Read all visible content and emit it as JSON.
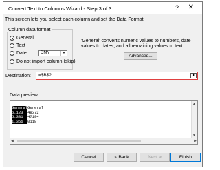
{
  "window": {
    "title": "Convert Text to Columns Wizard - Step 3 of 3",
    "help_glyph": "?",
    "close_glyph": "✕"
  },
  "instructions": "This screen lets you select each column and set the Data Format.",
  "column_format": {
    "group_label": "Column data format",
    "options": [
      {
        "label": "General",
        "selected": true
      },
      {
        "label": "Text",
        "selected": false
      },
      {
        "label": "Date:",
        "selected": false
      },
      {
        "label": "Do not import column (skip)",
        "selected": false
      }
    ],
    "date_format": "DMY"
  },
  "description": "'General' converts numeric values to numbers, date values to dates, and all remaining values to text.",
  "advanced_label": "Advanced...",
  "destination": {
    "label": "Destination:",
    "value": "=$B$2"
  },
  "preview": {
    "label": "Data preview",
    "rows": [
      [
        "General",
        "General"
      ],
      [
        "6.123",
        "48372"
      ],
      [
        "5.331",
        "47194"
      ],
      [
        "1.356",
        "0118"
      ]
    ]
  },
  "buttons": {
    "cancel": "Cancel",
    "back": "< Back",
    "next": "Next >",
    "finish": "Finish"
  }
}
